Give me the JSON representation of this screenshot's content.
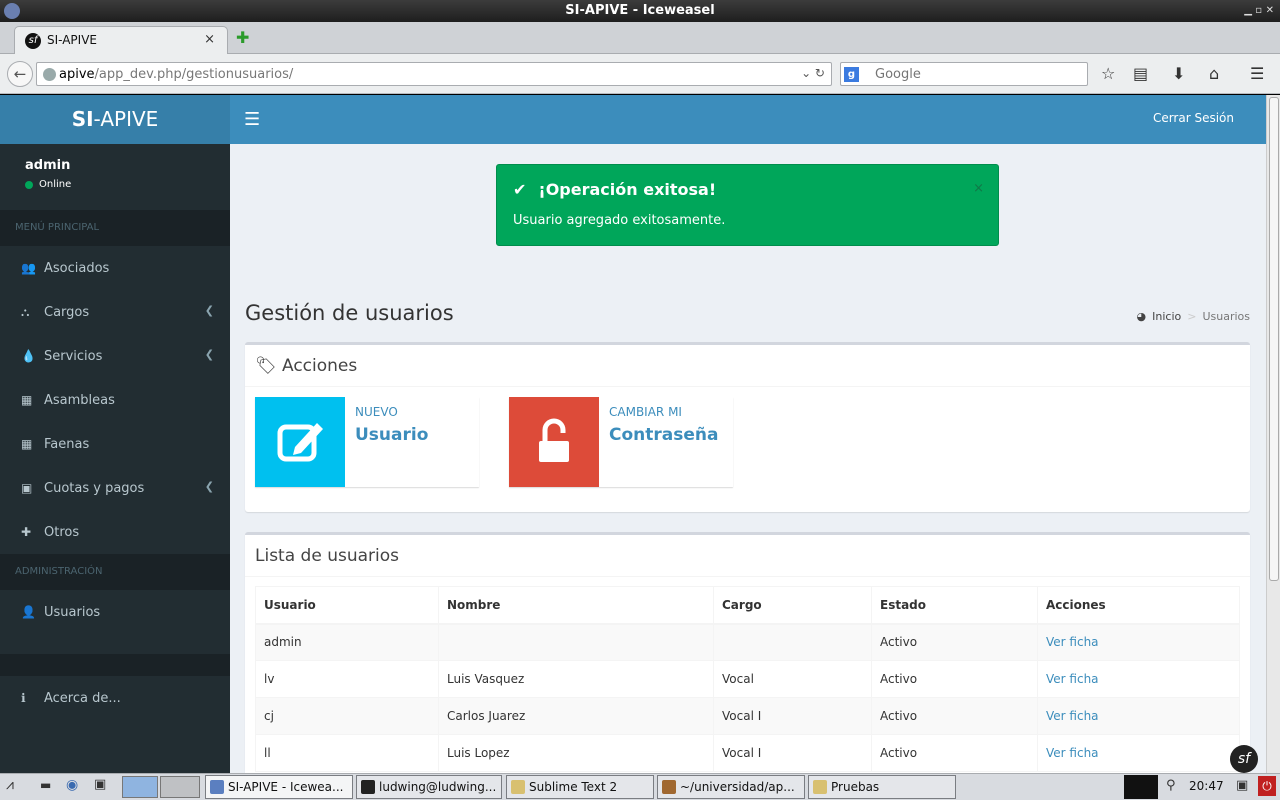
{
  "window": {
    "title": "SI-APIVE - Iceweasel"
  },
  "browser": {
    "tab_title": "SI-APIVE",
    "tab_close": "×",
    "new_tab": "✚",
    "url_domain": "apive",
    "url_path": "/app_dev.php/gestionusuarios/",
    "search_placeholder": "Google"
  },
  "app": {
    "logo_bold": "SI",
    "logo_rest": "-APIVE",
    "logout": "Cerrar Sesión"
  },
  "user": {
    "name": "admin",
    "status": "Online"
  },
  "sidebar": {
    "main_header": "MENÚ PRINCIPAL",
    "items": [
      {
        "label": "Asociados",
        "icon": "users-icon",
        "glyph": "👥",
        "chevron": false
      },
      {
        "label": "Cargos",
        "icon": "sitemap-icon",
        "glyph": "⛬",
        "chevron": true
      },
      {
        "label": "Servicios",
        "icon": "tint-icon",
        "glyph": "💧",
        "chevron": true
      },
      {
        "label": "Asambleas",
        "icon": "calendar-icon",
        "glyph": "▦",
        "chevron": false
      },
      {
        "label": "Faenas",
        "icon": "calendar-icon",
        "glyph": "▦",
        "chevron": false
      },
      {
        "label": "Cuotas y pagos",
        "icon": "money-icon",
        "glyph": "▣",
        "chevron": true
      },
      {
        "label": "Otros",
        "icon": "plus-icon",
        "glyph": "✚",
        "chevron": false
      }
    ],
    "admin_header": "ADMINISTRACIÓN",
    "admin_items": [
      {
        "label": "Usuarios",
        "icon": "user-icon",
        "glyph": "👤"
      }
    ],
    "about": {
      "label": "Acerca de...",
      "icon": "info-icon",
      "glyph": "ℹ"
    }
  },
  "alert": {
    "title": "¡Operación exitosa!",
    "body": "Usuario agregado exitosamente.",
    "close": "×"
  },
  "page": {
    "title": "Gestión de usuarios",
    "breadcrumb_home": "Inicio",
    "breadcrumb_current": "Usuarios"
  },
  "actions": {
    "title": "Acciones",
    "new_user": {
      "line1": "NUEVO",
      "line2": "Usuario",
      "color": "#00c0ef"
    },
    "change_password": {
      "line1": "CAMBIAR MI",
      "line2": "Contraseña",
      "color": "#dd4b39"
    }
  },
  "users": {
    "title": "Lista de usuarios",
    "columns": [
      "Usuario",
      "Nombre",
      "Cargo",
      "Estado",
      "Acciones"
    ],
    "rows": [
      [
        "admin",
        "",
        "",
        "Activo",
        "Ver ficha"
      ],
      [
        "lv",
        "Luis Vasquez",
        "Vocal",
        "Activo",
        "Ver ficha"
      ],
      [
        "cj",
        "Carlos Juarez",
        "Vocal I",
        "Activo",
        "Ver ficha"
      ],
      [
        "ll",
        "Luis Lopez",
        "Vocal I",
        "Activo",
        "Ver ficha"
      ]
    ]
  },
  "taskbar": {
    "windows": [
      "SI-APIVE - Icewea...",
      "ludwing@ludwing...",
      "Sublime Text 2",
      "~/universidad/ap...",
      "Pruebas"
    ],
    "clock": "20:47"
  },
  "colors": {
    "header": "#3c8dbc",
    "sidebar": "#222d32",
    "success": "#00a65a"
  }
}
